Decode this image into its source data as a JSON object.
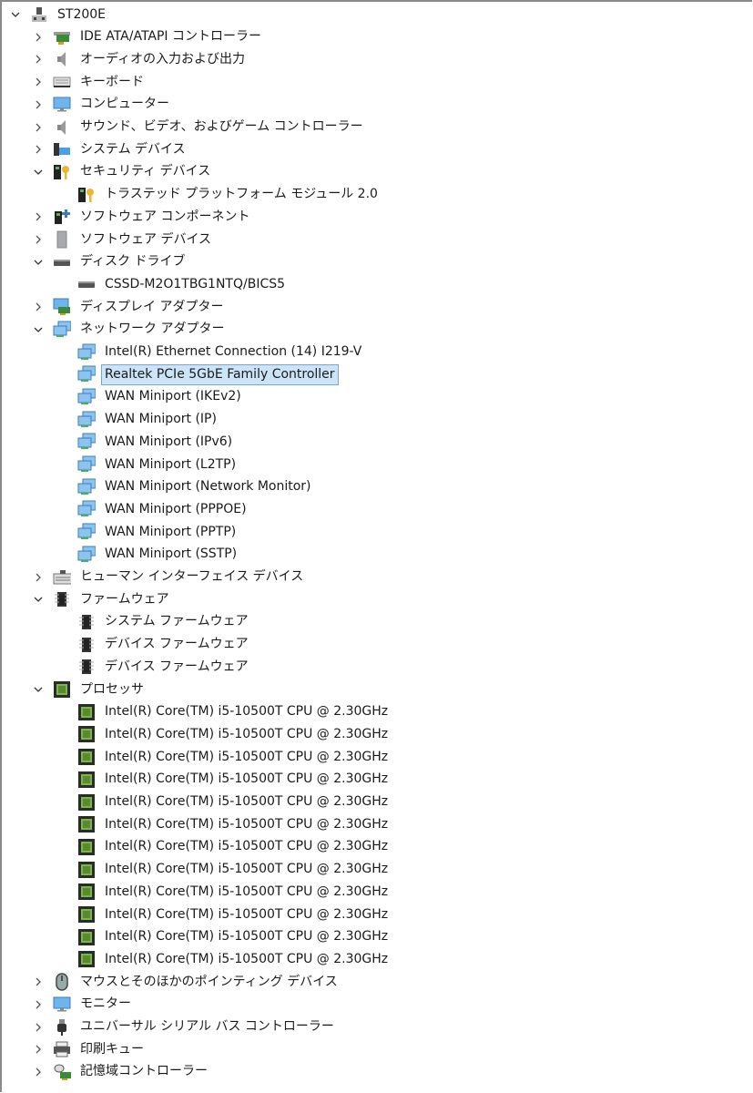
{
  "accent_selection": "#cce4f7",
  "tree": [
    {
      "label": "ST200E",
      "level": 0,
      "state": "expanded",
      "icon": "computer-root-icon"
    },
    {
      "label": "IDE ATA/ATAPI コントローラー",
      "level": 1,
      "state": "collapsed",
      "icon": "ide-controller-icon"
    },
    {
      "label": "オーディオの入力および出力",
      "level": 1,
      "state": "collapsed",
      "icon": "speaker-icon"
    },
    {
      "label": "キーボード",
      "level": 1,
      "state": "collapsed",
      "icon": "keyboard-icon"
    },
    {
      "label": "コンピューター",
      "level": 1,
      "state": "collapsed",
      "icon": "monitor-icon"
    },
    {
      "label": "サウンド、ビデオ、およびゲーム コントローラー",
      "level": 1,
      "state": "collapsed",
      "icon": "speaker-icon"
    },
    {
      "label": "システム デバイス",
      "level": 1,
      "state": "collapsed",
      "icon": "system-device-icon"
    },
    {
      "label": "セキュリティ デバイス",
      "level": 1,
      "state": "expanded",
      "icon": "security-key-icon"
    },
    {
      "label": "トラステッド プラットフォーム モジュール 2.0",
      "level": 2,
      "state": "leaf",
      "icon": "security-key-icon"
    },
    {
      "label": "ソフトウェア コンポーネント",
      "level": 1,
      "state": "collapsed",
      "icon": "software-component-icon"
    },
    {
      "label": "ソフトウェア デバイス",
      "level": 1,
      "state": "collapsed",
      "icon": "software-device-icon"
    },
    {
      "label": "ディスク ドライブ",
      "level": 1,
      "state": "expanded",
      "icon": "disk-drive-icon"
    },
    {
      "label": "CSSD-M2O1TBG1NTQ/BICS5",
      "level": 2,
      "state": "leaf",
      "icon": "disk-drive-icon"
    },
    {
      "label": "ディスプレイ アダプター",
      "level": 1,
      "state": "collapsed",
      "icon": "display-adapter-icon"
    },
    {
      "label": "ネットワーク アダプター",
      "level": 1,
      "state": "expanded",
      "icon": "network-adapter-icon"
    },
    {
      "label": "Intel(R) Ethernet Connection (14) I219-V",
      "level": 2,
      "state": "leaf",
      "icon": "network-adapter-icon"
    },
    {
      "label": "Realtek PCIe 5GbE Family Controller",
      "level": 2,
      "state": "leaf",
      "icon": "network-adapter-icon",
      "selected": true
    },
    {
      "label": "WAN Miniport (IKEv2)",
      "level": 2,
      "state": "leaf",
      "icon": "network-adapter-icon"
    },
    {
      "label": "WAN Miniport (IP)",
      "level": 2,
      "state": "leaf",
      "icon": "network-adapter-icon"
    },
    {
      "label": "WAN Miniport (IPv6)",
      "level": 2,
      "state": "leaf",
      "icon": "network-adapter-icon"
    },
    {
      "label": "WAN Miniport (L2TP)",
      "level": 2,
      "state": "leaf",
      "icon": "network-adapter-icon"
    },
    {
      "label": "WAN Miniport (Network Monitor)",
      "level": 2,
      "state": "leaf",
      "icon": "network-adapter-icon"
    },
    {
      "label": "WAN Miniport (PPPOE)",
      "level": 2,
      "state": "leaf",
      "icon": "network-adapter-icon"
    },
    {
      "label": "WAN Miniport (PPTP)",
      "level": 2,
      "state": "leaf",
      "icon": "network-adapter-icon"
    },
    {
      "label": "WAN Miniport (SSTP)",
      "level": 2,
      "state": "leaf",
      "icon": "network-adapter-icon"
    },
    {
      "label": "ヒューマン インターフェイス デバイス",
      "level": 1,
      "state": "collapsed",
      "icon": "hid-icon"
    },
    {
      "label": "ファームウェア",
      "level": 1,
      "state": "expanded",
      "icon": "firmware-icon"
    },
    {
      "label": "システム ファームウェア",
      "level": 2,
      "state": "leaf",
      "icon": "firmware-icon"
    },
    {
      "label": "デバイス ファームウェア",
      "level": 2,
      "state": "leaf",
      "icon": "firmware-icon"
    },
    {
      "label": "デバイス ファームウェア",
      "level": 2,
      "state": "leaf",
      "icon": "firmware-icon"
    },
    {
      "label": "プロセッサ",
      "level": 1,
      "state": "expanded",
      "icon": "processor-icon"
    },
    {
      "label": "Intel(R) Core(TM) i5-10500T CPU @ 2.30GHz",
      "level": 2,
      "state": "leaf",
      "icon": "processor-icon"
    },
    {
      "label": "Intel(R) Core(TM) i5-10500T CPU @ 2.30GHz",
      "level": 2,
      "state": "leaf",
      "icon": "processor-icon"
    },
    {
      "label": "Intel(R) Core(TM) i5-10500T CPU @ 2.30GHz",
      "level": 2,
      "state": "leaf",
      "icon": "processor-icon"
    },
    {
      "label": "Intel(R) Core(TM) i5-10500T CPU @ 2.30GHz",
      "level": 2,
      "state": "leaf",
      "icon": "processor-icon"
    },
    {
      "label": "Intel(R) Core(TM) i5-10500T CPU @ 2.30GHz",
      "level": 2,
      "state": "leaf",
      "icon": "processor-icon"
    },
    {
      "label": "Intel(R) Core(TM) i5-10500T CPU @ 2.30GHz",
      "level": 2,
      "state": "leaf",
      "icon": "processor-icon"
    },
    {
      "label": "Intel(R) Core(TM) i5-10500T CPU @ 2.30GHz",
      "level": 2,
      "state": "leaf",
      "icon": "processor-icon"
    },
    {
      "label": "Intel(R) Core(TM) i5-10500T CPU @ 2.30GHz",
      "level": 2,
      "state": "leaf",
      "icon": "processor-icon"
    },
    {
      "label": "Intel(R) Core(TM) i5-10500T CPU @ 2.30GHz",
      "level": 2,
      "state": "leaf",
      "icon": "processor-icon"
    },
    {
      "label": "Intel(R) Core(TM) i5-10500T CPU @ 2.30GHz",
      "level": 2,
      "state": "leaf",
      "icon": "processor-icon"
    },
    {
      "label": "Intel(R) Core(TM) i5-10500T CPU @ 2.30GHz",
      "level": 2,
      "state": "leaf",
      "icon": "processor-icon"
    },
    {
      "label": "Intel(R) Core(TM) i5-10500T CPU @ 2.30GHz",
      "level": 2,
      "state": "leaf",
      "icon": "processor-icon"
    },
    {
      "label": "マウスとそのほかのポインティング デバイス",
      "level": 1,
      "state": "collapsed",
      "icon": "mouse-icon"
    },
    {
      "label": "モニター",
      "level": 1,
      "state": "collapsed",
      "icon": "monitor-icon"
    },
    {
      "label": "ユニバーサル シリアル バス コントローラー",
      "level": 1,
      "state": "collapsed",
      "icon": "usb-icon"
    },
    {
      "label": "印刷キュー",
      "level": 1,
      "state": "collapsed",
      "icon": "printer-icon"
    },
    {
      "label": "記憶域コントローラー",
      "level": 1,
      "state": "collapsed",
      "icon": "storage-controller-icon"
    }
  ]
}
